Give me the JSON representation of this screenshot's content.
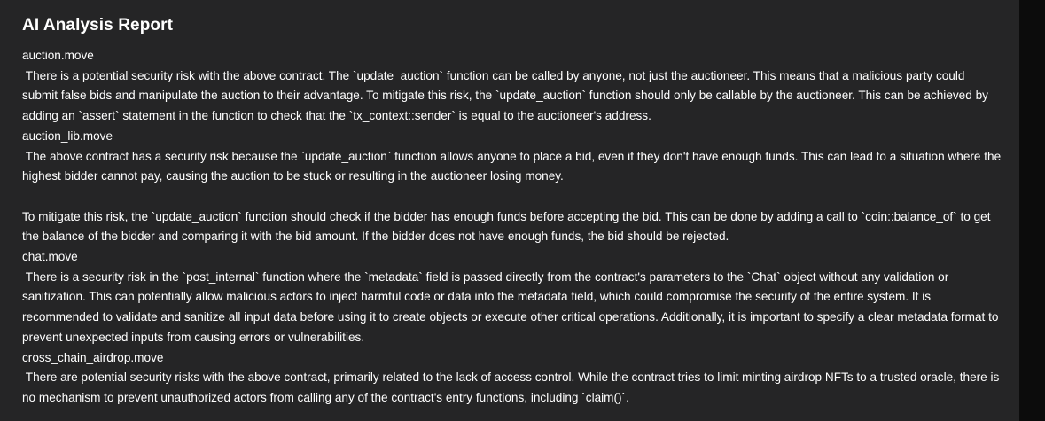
{
  "report": {
    "title": "AI Analysis Report",
    "entries": [
      {
        "file": "auction.move",
        "analysis": " There is a potential security risk with the above contract. The `update_auction` function can be called by anyone, not just the auctioneer. This means that a malicious party could submit false bids and manipulate the auction to their advantage. To mitigate this risk, the `update_auction` function should only be callable by the auctioneer. This can be achieved by adding an `assert` statement in the function to check that the `tx_context::sender` is equal to the auctioneer's address."
      },
      {
        "file": "auction_lib.move",
        "analysis": " The above contract has a security risk because the `update_auction` function allows anyone to place a bid, even if they don't have enough funds. This can lead to a situation where the highest bidder cannot pay, causing the auction to be stuck or resulting in the auctioneer losing money.\n\nTo mitigate this risk, the `update_auction` function should check if the bidder has enough funds before accepting the bid. This can be done by adding a call to `coin::balance_of` to get the balance of the bidder and comparing it with the bid amount. If the bidder does not have enough funds, the bid should be rejected."
      },
      {
        "file": "chat.move",
        "analysis": " There is a security risk in the `post_internal` function where the `metadata` field is passed directly from the contract's parameters to the `Chat` object without any validation or sanitization. This can potentially allow malicious actors to inject harmful code or data into the metadata field, which could compromise the security of the entire system. It is recommended to validate and sanitize all input data before using it to create objects or execute other critical operations. Additionally, it is important to specify a clear metadata format to prevent unexpected inputs from causing errors or vulnerabilities."
      },
      {
        "file": "cross_chain_airdrop.move",
        "analysis": " There are potential security risks with the above contract, primarily related to the lack of access control. While the contract tries to limit minting airdrop NFTs to a trusted oracle, there is no mechanism to prevent unauthorized actors from calling any of the contract's entry functions, including `claim()`."
      }
    ]
  }
}
